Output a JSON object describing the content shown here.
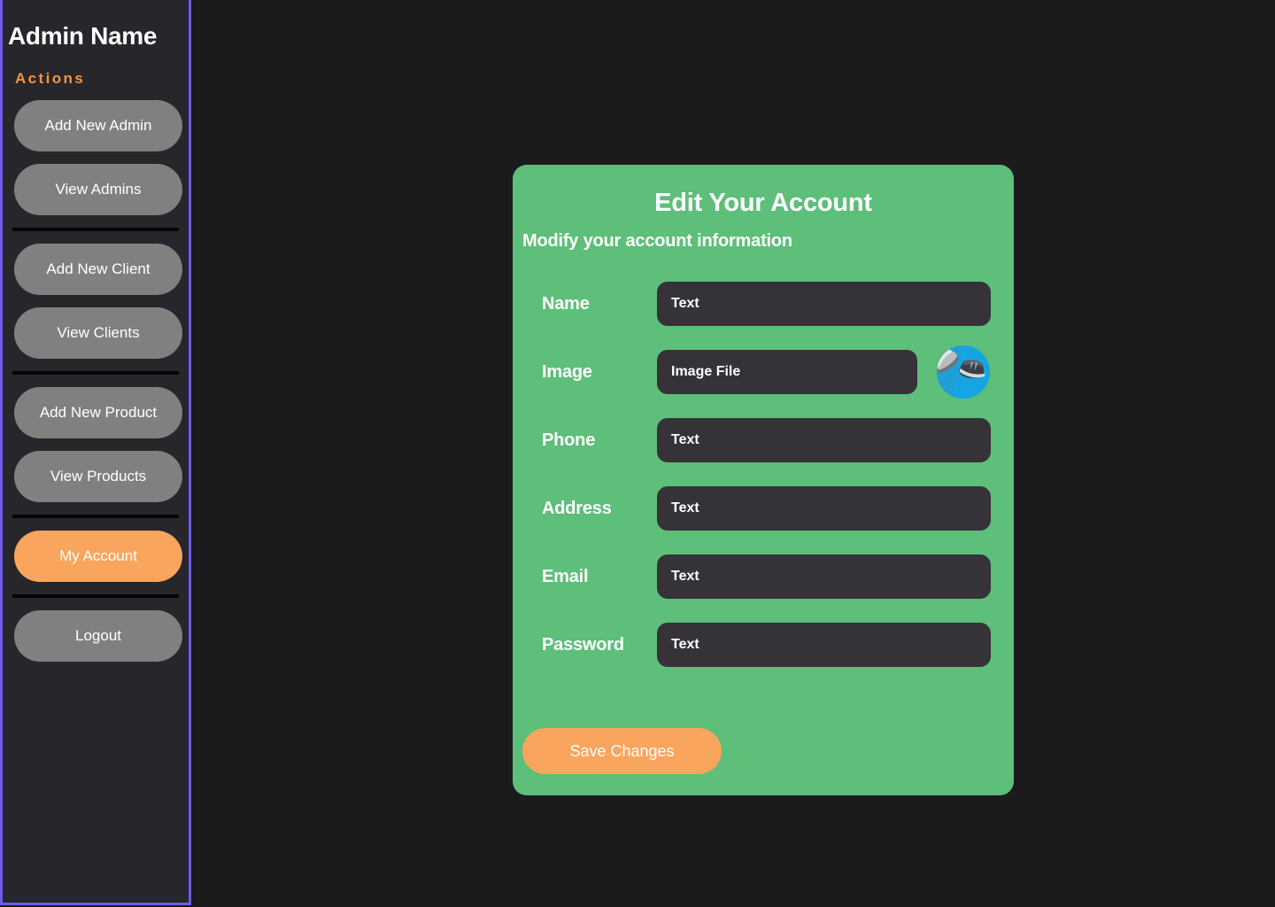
{
  "sidebar": {
    "title": "Admin Name",
    "section_label": "Actions",
    "groups": [
      {
        "items": [
          {
            "label": "Add New Admin",
            "active": false
          },
          {
            "label": "View Admins",
            "active": false
          }
        ]
      },
      {
        "items": [
          {
            "label": "Add New Client",
            "active": false
          },
          {
            "label": "View Clients",
            "active": false
          }
        ]
      },
      {
        "items": [
          {
            "label": "Add New Product",
            "active": false
          },
          {
            "label": "View Products",
            "active": false
          }
        ]
      },
      {
        "items": [
          {
            "label": "My Account",
            "active": true
          }
        ]
      },
      {
        "items": [
          {
            "label": "Logout",
            "active": false
          }
        ]
      }
    ]
  },
  "card": {
    "title": "Edit Your Account",
    "subtitle": "Modify your account information",
    "fields": [
      {
        "label": "Name",
        "placeholder": "Text",
        "type": "text",
        "has_avatar": false
      },
      {
        "label": "Image",
        "placeholder": "Image File",
        "type": "text",
        "has_avatar": true
      },
      {
        "label": "Phone",
        "placeholder": "Text",
        "type": "text",
        "has_avatar": false
      },
      {
        "label": "Address",
        "placeholder": "Text",
        "type": "text",
        "has_avatar": false
      },
      {
        "label": "Email",
        "placeholder": "Text",
        "type": "text",
        "has_avatar": false
      },
      {
        "label": "Password",
        "placeholder": "Text",
        "type": "text",
        "has_avatar": false
      }
    ],
    "avatar_alt": "sneakers-avatar",
    "save_label": "Save Changes"
  },
  "colors": {
    "page_background": "#1b1b1d",
    "sidebar_background": "#26262b",
    "sidebar_border": "#6c5ce7",
    "accent_orange": "#f9a55d",
    "actions_label": "#f6943e",
    "card_green": "#5dbf79",
    "input_dark": "#353238",
    "button_grey": "#808080",
    "divider_black": "#050505",
    "avatar_blue": "#1aa7e0"
  }
}
